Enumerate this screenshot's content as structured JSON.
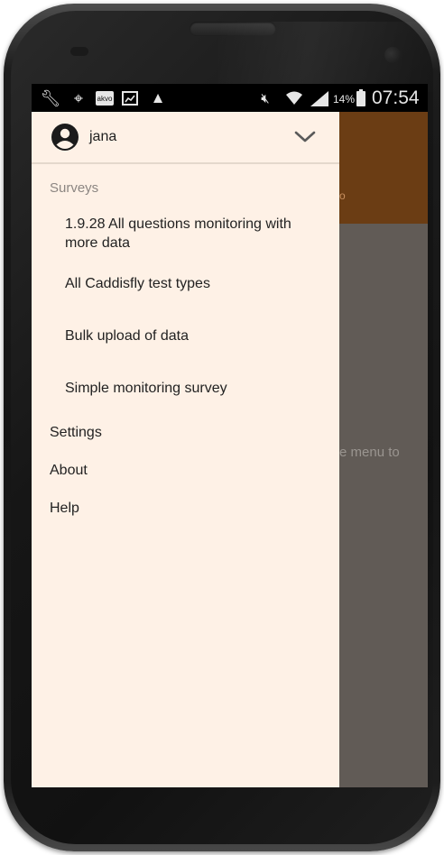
{
  "status_bar": {
    "icons": [
      "wrench-icon",
      "gps-icon",
      "akvo-icon",
      "image-icon",
      "warning-icon",
      "mute-icon",
      "wifi-icon",
      "signal-icon",
      "battery-icon"
    ],
    "akvo_label": "akvo",
    "battery_percent": "14%",
    "time": "07:54"
  },
  "background_app": {
    "toolbar_color": "#6b3d14",
    "toolbar_fragment": "o",
    "body_fragment": "e menu to"
  },
  "drawer": {
    "account": {
      "name": "jana",
      "icon": "account-circle-icon",
      "expand_icon": "chevron-down-icon"
    },
    "surveys_header": "Surveys",
    "surveys": [
      {
        "label": "1.9.28 All questions monitoring with more data"
      },
      {
        "label": "All Caddisfly test types"
      },
      {
        "label": "Bulk upload of data"
      },
      {
        "label": "Simple monitoring survey"
      }
    ],
    "menu": [
      {
        "label": "Settings"
      },
      {
        "label": "About"
      },
      {
        "label": "Help"
      }
    ],
    "background_color": "#fef1e6"
  }
}
